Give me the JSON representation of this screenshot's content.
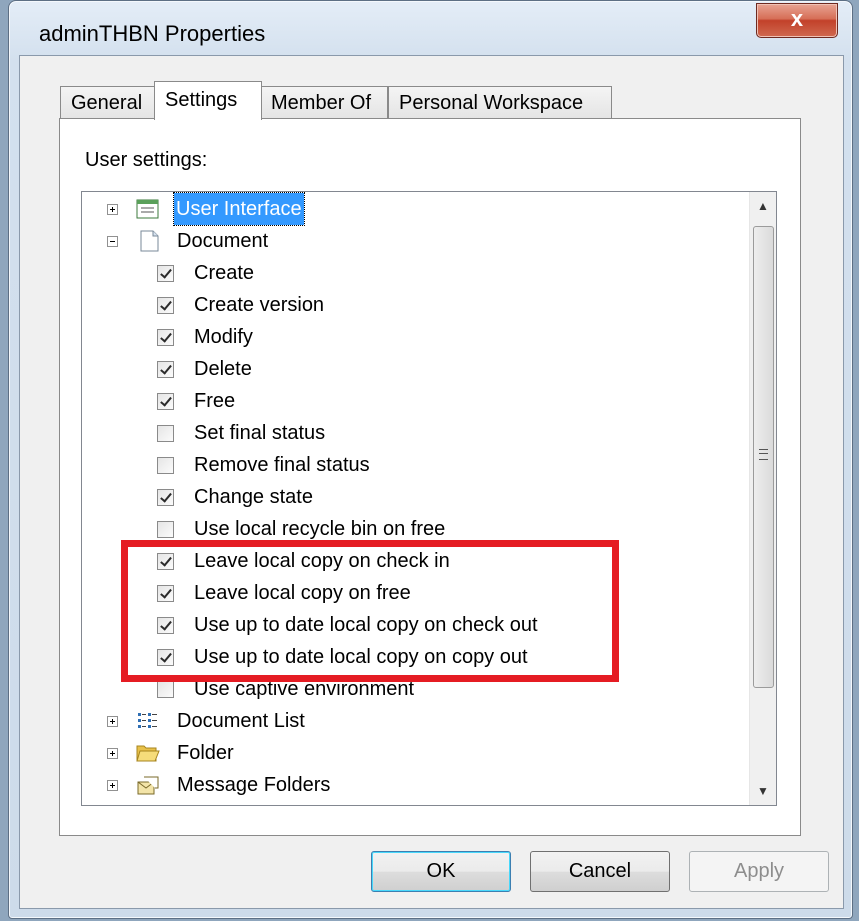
{
  "window": {
    "title": "adminTHBN Properties",
    "close_glyph": "x"
  },
  "tabs": [
    {
      "label": "General",
      "active": false
    },
    {
      "label": "Settings",
      "active": true
    },
    {
      "label": "Member Of",
      "active": false
    },
    {
      "label": "Personal Workspace",
      "active": false
    }
  ],
  "settings": {
    "group_label": "User settings:",
    "tree": {
      "user_interface": {
        "label": "User Interface",
        "expanded": false,
        "selected": true,
        "icon": "window-icon"
      },
      "document": {
        "label": "Document",
        "expanded": true,
        "icon": "document-icon",
        "items": [
          {
            "label": "Create",
            "checked": true
          },
          {
            "label": "Create version",
            "checked": true
          },
          {
            "label": "Modify",
            "checked": true
          },
          {
            "label": "Delete",
            "checked": true
          },
          {
            "label": "Free",
            "checked": true
          },
          {
            "label": "Set final status",
            "checked": false
          },
          {
            "label": "Remove final status",
            "checked": false
          },
          {
            "label": "Change state",
            "checked": true
          },
          {
            "label": "Use local recycle bin on free",
            "checked": false
          },
          {
            "label": "Leave local copy on check in",
            "checked": true
          },
          {
            "label": "Leave local copy on free",
            "checked": true
          },
          {
            "label": "Use up to date local copy on check out",
            "checked": true
          },
          {
            "label": "Use up to date local copy on copy out",
            "checked": true
          },
          {
            "label": "Use captive environment",
            "checked": false
          }
        ]
      },
      "document_list": {
        "label": "Document List",
        "expanded": false,
        "icon": "list-icon"
      },
      "folder": {
        "label": "Folder",
        "expanded": false,
        "icon": "folder-icon"
      },
      "message_folders": {
        "label": "Message Folders",
        "expanded": false,
        "icon": "envelope-icon"
      }
    }
  },
  "buttons": {
    "ok": "OK",
    "cancel": "Cancel",
    "apply": "Apply"
  },
  "colors": {
    "highlight": "#e51c23",
    "selection": "#3399ff"
  }
}
